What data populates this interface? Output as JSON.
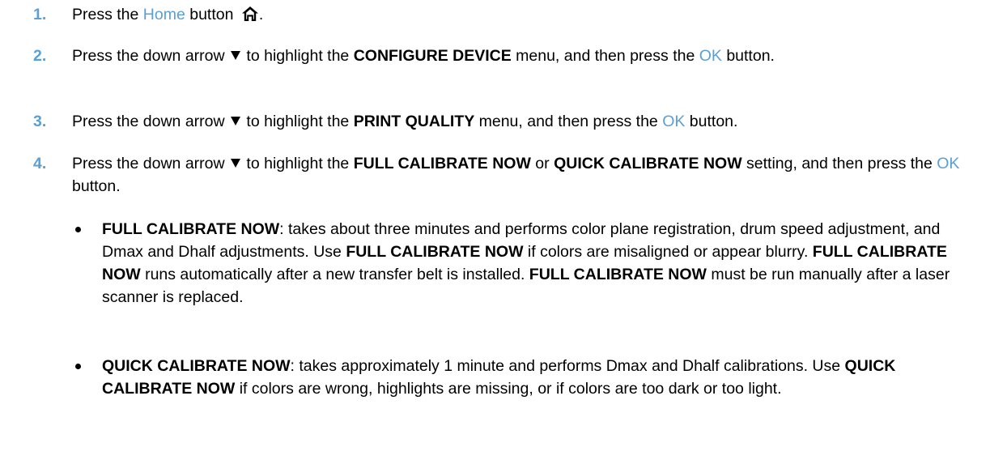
{
  "steps": [
    {
      "number": "1.",
      "t1": "Press the ",
      "home_label": "Home",
      "t2": " button ",
      "t3": "."
    },
    {
      "number": "2.",
      "t1": "Press the down arrow ",
      "t2": " to highlight the ",
      "menu": "CONFIGURE DEVICE",
      "t3": " menu, and then press the ",
      "ok_label": "OK",
      "t4": " button."
    },
    {
      "number": "3.",
      "t1": "Press the down arrow ",
      "t2": " to highlight the ",
      "menu": "PRINT QUALITY",
      "t3": " menu, and then press the ",
      "ok_label": "OK",
      "t4": " button."
    },
    {
      "number": "4.",
      "t1": "Press the down arrow ",
      "t2": " to highlight the ",
      "option1": "FULL CALIBRATE NOW",
      "t3": " or ",
      "option2": "QUICK CALIBRATE NOW",
      "t4": " setting, and then press the ",
      "ok_label": "OK",
      "t5": " button."
    }
  ],
  "bullets": [
    {
      "b1": "FULL CALIBRATE NOW",
      "t1": ": takes about three minutes and performs color plane registration, drum speed adjustment, and Dmax and Dhalf adjustments. Use ",
      "b2": "FULL CALIBRATE NOW",
      "t2": " if colors are misaligned or appear blurry. ",
      "b3": "FULL CALIBRATE NOW",
      "t3": " runs automatically after a new transfer belt is installed. ",
      "b4": "FULL CALIBRATE NOW",
      "t4": " must be run manually after a laser scanner is replaced."
    },
    {
      "b1": "QUICK CALIBRATE NOW",
      "t1": ": takes approximately 1 minute and performs Dmax and Dhalf calibrations. Use ",
      "b2": "QUICK CALIBRATE NOW",
      "t2": " if colors are wrong, highlights are missing, or if colors are too dark or too light."
    }
  ],
  "icons": {
    "home": "home-icon",
    "down_arrow": "down-arrow-icon",
    "bullet": "bullet-icon"
  },
  "colors": {
    "accent": "#5aa0d6",
    "text": "#000000"
  }
}
